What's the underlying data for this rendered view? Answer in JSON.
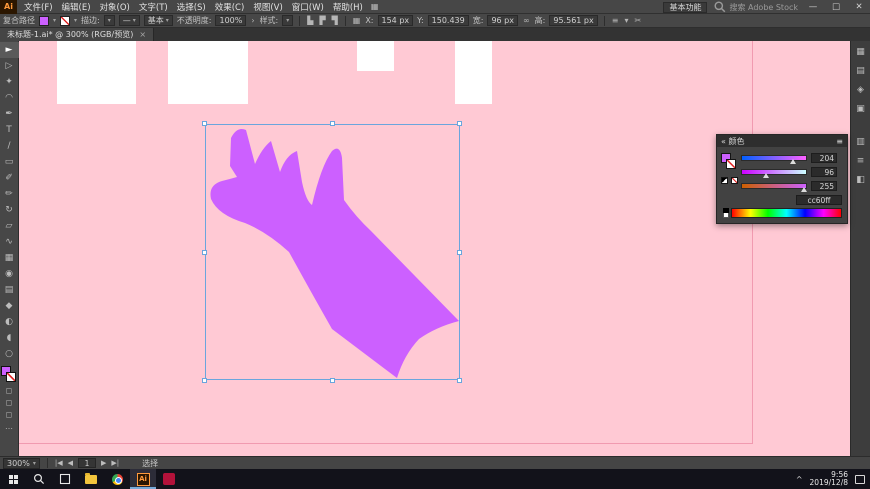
{
  "colors": {
    "canvas_pink": "#ffc9d4",
    "artboard_edge": "#ee8fa6",
    "shape_purple": "#cc60ff",
    "selection_blue": "#6aa5dd"
  },
  "titlebar": {
    "logo": "Ai",
    "menus": [
      "文件(F)",
      "编辑(E)",
      "对象(O)",
      "文字(T)",
      "选择(S)",
      "效果(C)",
      "视图(V)",
      "窗口(W)",
      "帮助(H)"
    ],
    "grid_icon": "▦",
    "workspace_switcher": "基本功能",
    "stock_search": "搜索 Adobe Stock",
    "minimize": "—",
    "maximize": "□",
    "close": "✕"
  },
  "controlbar": {
    "selection_label": "复合路径",
    "dropdown_arrow": "▾",
    "stroke_label": "描边:",
    "profile_glyph": "—",
    "brush_name": "基本",
    "opacity_label": "不透明度:",
    "opacity_value": "100%",
    "opacity_more": "›",
    "style_label": "样式:",
    "align_icon1": "▙",
    "align_icon2": "▛",
    "align_icon3": "▜",
    "transform_icon": "▦",
    "x_label": "X:",
    "x_value": "154 px",
    "y_label": "Y:",
    "y_value": "150.439",
    "w_label": "宽:",
    "w_value": "96 px",
    "link_icon": "∞",
    "h_label": "高:",
    "h_value": "95.561 px",
    "extra_icon1": "≡",
    "extra_icon2": "▾",
    "extra_icon3": "✂"
  },
  "tabbar": {
    "doc_title": "未标题-1.ai* @ 300% (RGB/预览)",
    "close": "×"
  },
  "toolbar": {
    "tools": [
      {
        "glyph": "►"
      },
      {
        "glyph": "▷"
      },
      {
        "glyph": "✦"
      },
      {
        "glyph": "◠"
      },
      {
        "glyph": "✒"
      },
      {
        "glyph": "T"
      },
      {
        "glyph": "/"
      },
      {
        "glyph": "▭"
      },
      {
        "glyph": "✐"
      },
      {
        "glyph": "✏"
      },
      {
        "glyph": "↻"
      },
      {
        "glyph": "▱"
      },
      {
        "glyph": "∿"
      },
      {
        "glyph": "▦"
      },
      {
        "glyph": "◉"
      },
      {
        "glyph": "▤"
      },
      {
        "glyph": "◆"
      },
      {
        "glyph": "◐"
      },
      {
        "glyph": "◖"
      },
      {
        "glyph": "○"
      }
    ],
    "mode_icons": [
      {
        "glyph": "◻"
      },
      {
        "glyph": "◻"
      },
      {
        "glyph": "◻"
      },
      {
        "glyph": "…"
      }
    ]
  },
  "dock": {
    "icons": [
      {
        "glyph": "▦"
      },
      {
        "glyph": "▤"
      },
      {
        "glyph": "◈"
      },
      {
        "glyph": "▣"
      },
      {
        "glyph": "▥"
      },
      {
        "glyph": "≡"
      },
      {
        "glyph": "◧"
      }
    ]
  },
  "color_panel": {
    "collapse_icon": "«",
    "title": "颜色",
    "menu_icon": "≡",
    "sliders": [
      {
        "value": "204"
      },
      {
        "value": "96"
      },
      {
        "value": "255"
      }
    ],
    "hex": "cc60ff"
  },
  "statusbar": {
    "zoom": "300%",
    "zoom_arrow": "▾",
    "nav_first": "|◀",
    "nav_prev": "◀",
    "artboard_current": "1",
    "nav_next": "▶",
    "nav_last": "▶|",
    "status_text": "选择"
  },
  "taskbar": {
    "ai_label": "Ai",
    "tray_arrow": "^",
    "time": "9:56",
    "date": "2019/12/8"
  }
}
